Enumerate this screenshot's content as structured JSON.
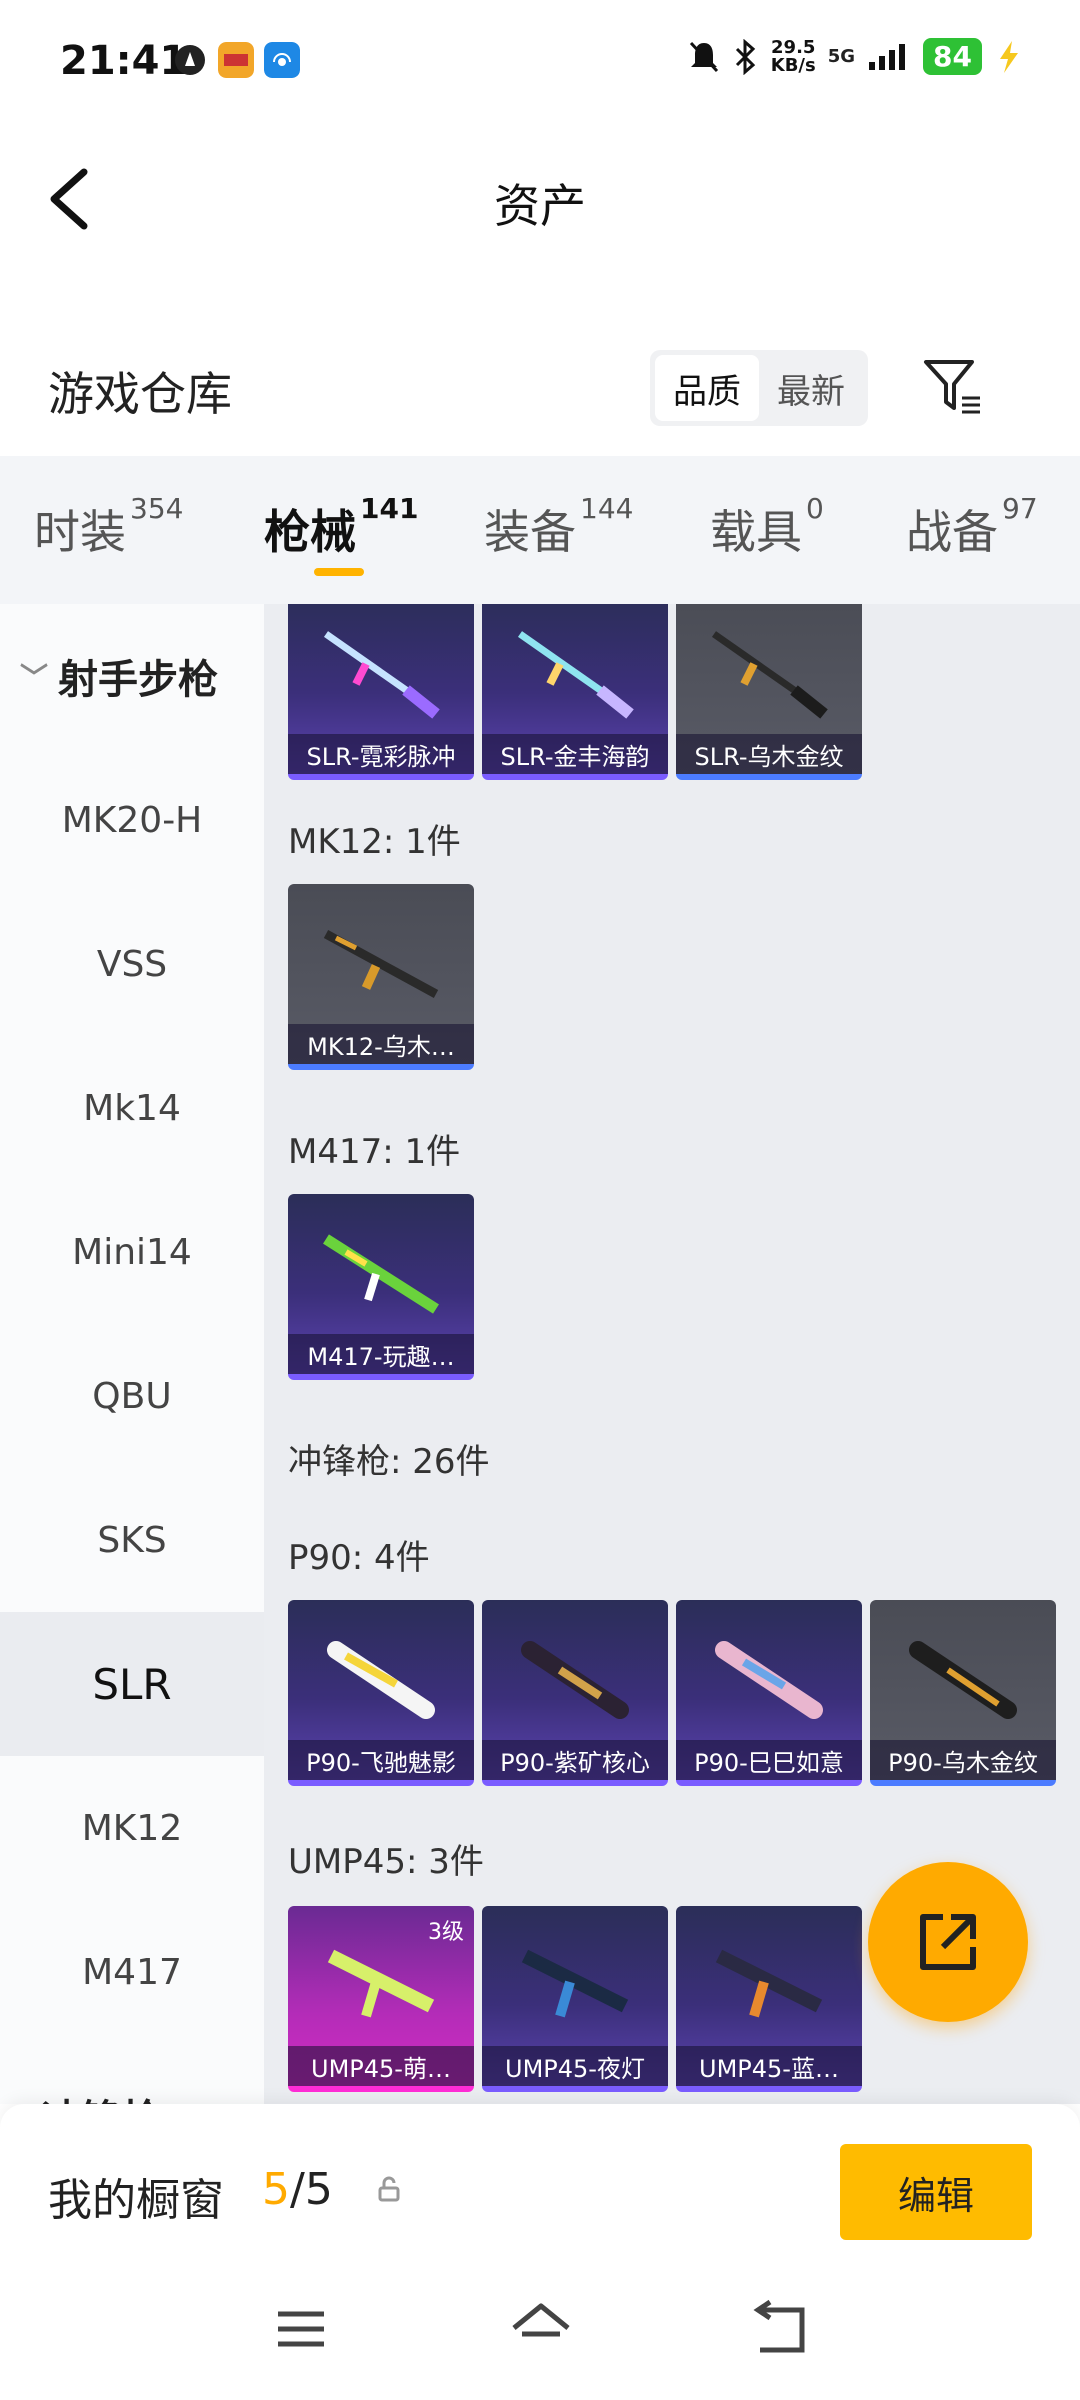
{
  "status": {
    "time": "21:41",
    "speed_top": "29.5",
    "speed_bottom": "KB/s",
    "network": "5G",
    "battery": "84"
  },
  "header": {
    "title": "资产"
  },
  "warehouse": {
    "title": "游戏仓库",
    "sort_options": [
      "品质",
      "最新"
    ],
    "sort_active": "品质"
  },
  "tabs": [
    {
      "label": "时装",
      "count": "354"
    },
    {
      "label": "枪械",
      "count": "141"
    },
    {
      "label": "装备",
      "count": "144"
    },
    {
      "label": "载具",
      "count": "0"
    },
    {
      "label": "战备",
      "count": "97"
    }
  ],
  "active_tab": "枪械",
  "sidebar": {
    "group": "射手步枪",
    "items": [
      "MK20-H",
      "VSS",
      "Mk14",
      "Mini14",
      "QBU",
      "SKS",
      "SLR",
      "MK12",
      "M417"
    ],
    "active": "SLR",
    "next_group_partial": "冲锋枪"
  },
  "content": {
    "slr_items": [
      "SLR-霓彩脉冲",
      "SLR-金丰海韵",
      "SLR-乌木金纹"
    ],
    "mk12": {
      "title": "MK12: 1件",
      "items": [
        "MK12-乌木…"
      ]
    },
    "m417": {
      "title": "M417: 1件",
      "items": [
        "M417-玩趣…"
      ]
    },
    "smg_title": "冲锋枪: 26件",
    "p90": {
      "title": "P90: 4件",
      "items": [
        "P90-飞驰魅影",
        "P90-紫矿核心",
        "P90-巳巳如意",
        "P90-乌木金纹"
      ]
    },
    "ump45": {
      "title": "UMP45: 3件",
      "items": [
        "UMP45-萌…",
        "UMP45-夜灯",
        "UMP45-蓝…"
      ],
      "level_badge": "3级"
    }
  },
  "bottom": {
    "label": "我的橱窗",
    "current": "5",
    "total": "/5",
    "edit_button": "编辑"
  },
  "colors": {
    "accent": "#ffaa00",
    "purple_card": "#3b2f7a",
    "gray_card": "#595b66",
    "pink_card": "#b42cb8"
  }
}
